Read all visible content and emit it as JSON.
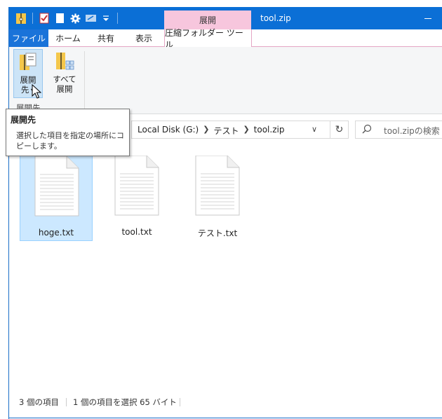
{
  "window": {
    "title": "tool.zip",
    "context_group": "展開"
  },
  "tabs": {
    "file": "ファイル",
    "home": "ホーム",
    "share": "共有",
    "view": "表示",
    "tools": "圧縮フォルダー ツール"
  },
  "ribbon": {
    "extract_to_line1": "展開",
    "extract_to_line2": "先",
    "extract_all_line1": "すべて",
    "extract_all_line2": "展開",
    "group_label": "展開先"
  },
  "tooltip": {
    "title": "展開先",
    "body": "選択した項目を指定の場所にコピーします。"
  },
  "address": {
    "crumbs": [
      "Local Disk (G:)",
      "テスト",
      "tool.zip"
    ],
    "search_placeholder": "tool.zipの検索"
  },
  "files": [
    {
      "name": "hoge.txt",
      "selected": true
    },
    {
      "name": "tool.txt",
      "selected": false
    },
    {
      "name": "テスト.txt",
      "selected": false
    }
  ],
  "status": {
    "count": "3 個の項目",
    "selection": "1 個の項目を選択  65 バイト"
  },
  "colors": {
    "titlebar": "#0b6fd6",
    "file_tab": "#1a73d9",
    "context_tab": "#f7c6dd",
    "selection": "#cce8ff"
  }
}
